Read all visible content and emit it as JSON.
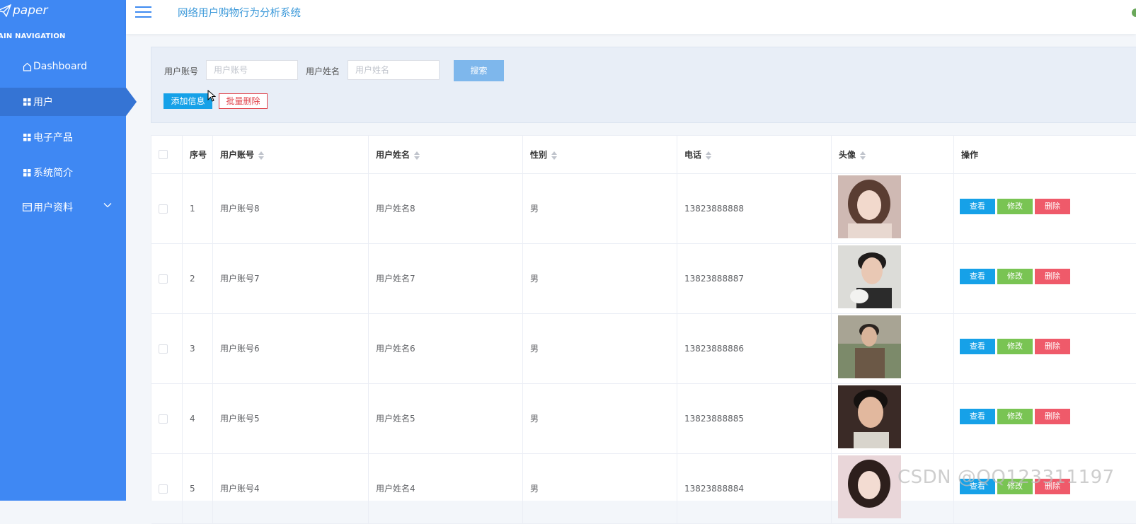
{
  "sidebar": {
    "logo_text": "paper",
    "nav_header": "AIN NAVIGATION",
    "items": [
      {
        "label": "Dashboard",
        "icon": "home-icon"
      },
      {
        "label": "用户",
        "icon": "grid-icon"
      },
      {
        "label": "电子产品",
        "icon": "grid-icon"
      },
      {
        "label": "系统简介",
        "icon": "grid-icon"
      },
      {
        "label": "用户资料",
        "icon": "calendar-icon"
      }
    ],
    "active_index": 1
  },
  "topbar": {
    "title": "网络用户购物行为分析系统"
  },
  "search": {
    "account_label": "用户账号",
    "account_placeholder": "用户账号",
    "name_label": "用户姓名",
    "name_placeholder": "用户姓名",
    "search_button": "搜索",
    "add_button": "添加信息",
    "batch_delete_button": "批量删除"
  },
  "table": {
    "headers": [
      "序号",
      "用户账号",
      "用户姓名",
      "性别",
      "电话",
      "头像",
      "操作"
    ],
    "rows": [
      {
        "index": "1",
        "account": "用户账号8",
        "name": "用户姓名8",
        "gender": "男",
        "phone": "13823888888"
      },
      {
        "index": "2",
        "account": "用户账号7",
        "name": "用户姓名7",
        "gender": "男",
        "phone": "13823888887"
      },
      {
        "index": "3",
        "account": "用户账号6",
        "name": "用户姓名6",
        "gender": "男",
        "phone": "13823888886"
      },
      {
        "index": "4",
        "account": "用户账号5",
        "name": "用户姓名5",
        "gender": "男",
        "phone": "13823888885"
      },
      {
        "index": "5",
        "account": "用户账号4",
        "name": "用户姓名4",
        "gender": "男",
        "phone": "13823888884"
      }
    ],
    "actions": {
      "view": "查看",
      "edit": "修改",
      "remove": "删除"
    }
  },
  "watermark": "CSDN @QQ123311197",
  "colors": {
    "sidebar_bg": "#3f88f3",
    "sidebar_active": "#3574d4",
    "title_color": "#3a98d9",
    "view_btn": "#16a1e8",
    "edit_btn": "#79c453",
    "remove_btn": "#ef5a6a"
  }
}
